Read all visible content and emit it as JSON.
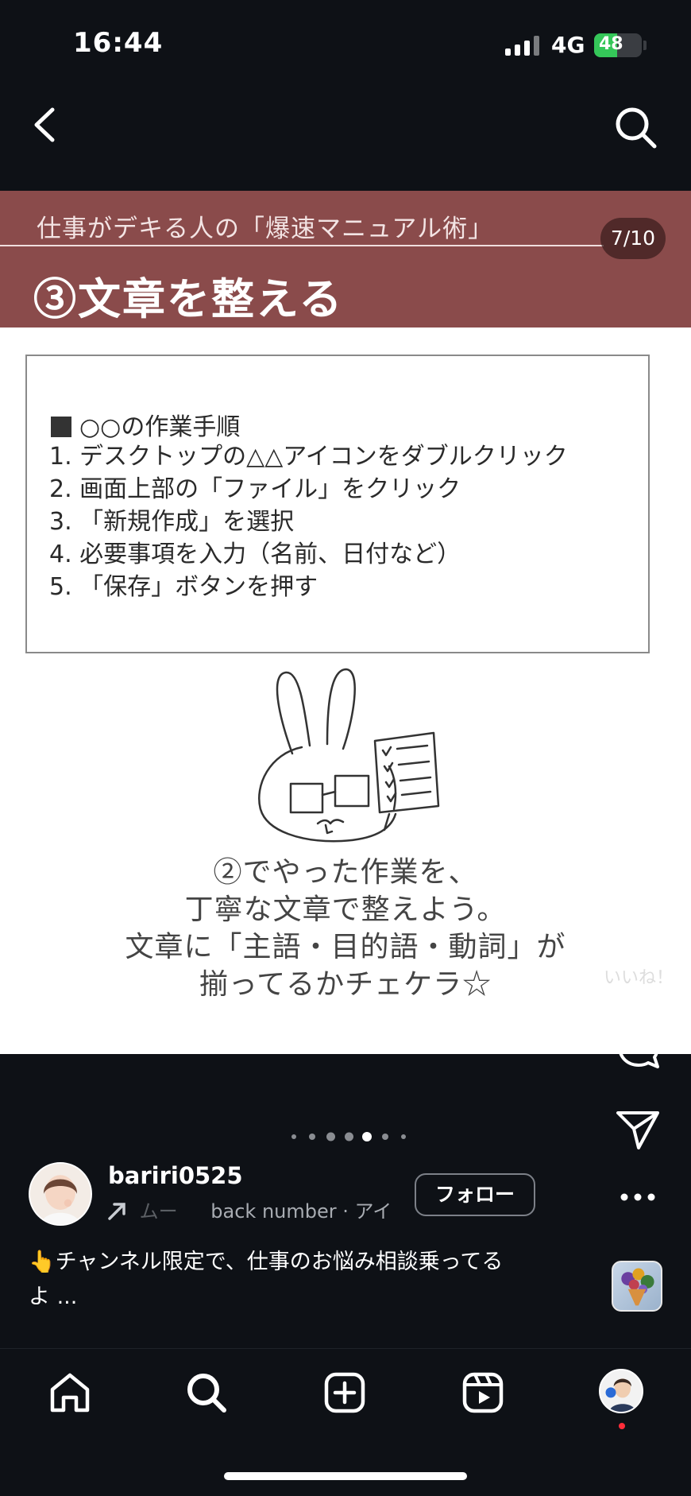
{
  "status_bar": {
    "time": "16:44",
    "network": "4G",
    "battery": "48",
    "battery_level": 0.48
  },
  "slide": {
    "subtitle": "仕事がデキる人の「爆速マニュアル術」",
    "title": "③文章を整える",
    "page_indicator": "7/10",
    "procedure_heading": "○○の作業手順",
    "steps": [
      "1. デスクトップの△△アイコンをダブルクリック",
      "2. 画面上部の「ファイル」をクリック",
      "3. 「新規作成」を選択",
      "4. 必要事項を入力（名前、日付など）",
      "5. 「保存」ボタンを押す"
    ],
    "caption_lines": [
      "②でやった作業を、",
      "丁寧な文章で整えよう。",
      "文章に「主語・目的語・動詞」が",
      "揃ってるかチェケラ☆"
    ]
  },
  "carousel": {
    "dot_count": 7,
    "active_index": 4
  },
  "actions": {
    "like_label": "いいね！"
  },
  "post": {
    "username": "bariri0525",
    "music_prefix": "ムー",
    "music_text": "back number · アイラ",
    "follow_label": "フォロー",
    "caption_line1": "👆チャンネル限定で、仕事のお悩み相談乗ってる",
    "caption_line2": "よ ..."
  },
  "colors": {
    "banner": "#8a4b4b",
    "background": "#0e1116",
    "battery": "#35c759",
    "notification": "#ff2d3a"
  },
  "icons": [
    "back-icon",
    "search-icon",
    "heart-icon",
    "comment-icon",
    "share-icon",
    "more-icon",
    "home-icon",
    "create-icon",
    "reels-icon"
  ]
}
